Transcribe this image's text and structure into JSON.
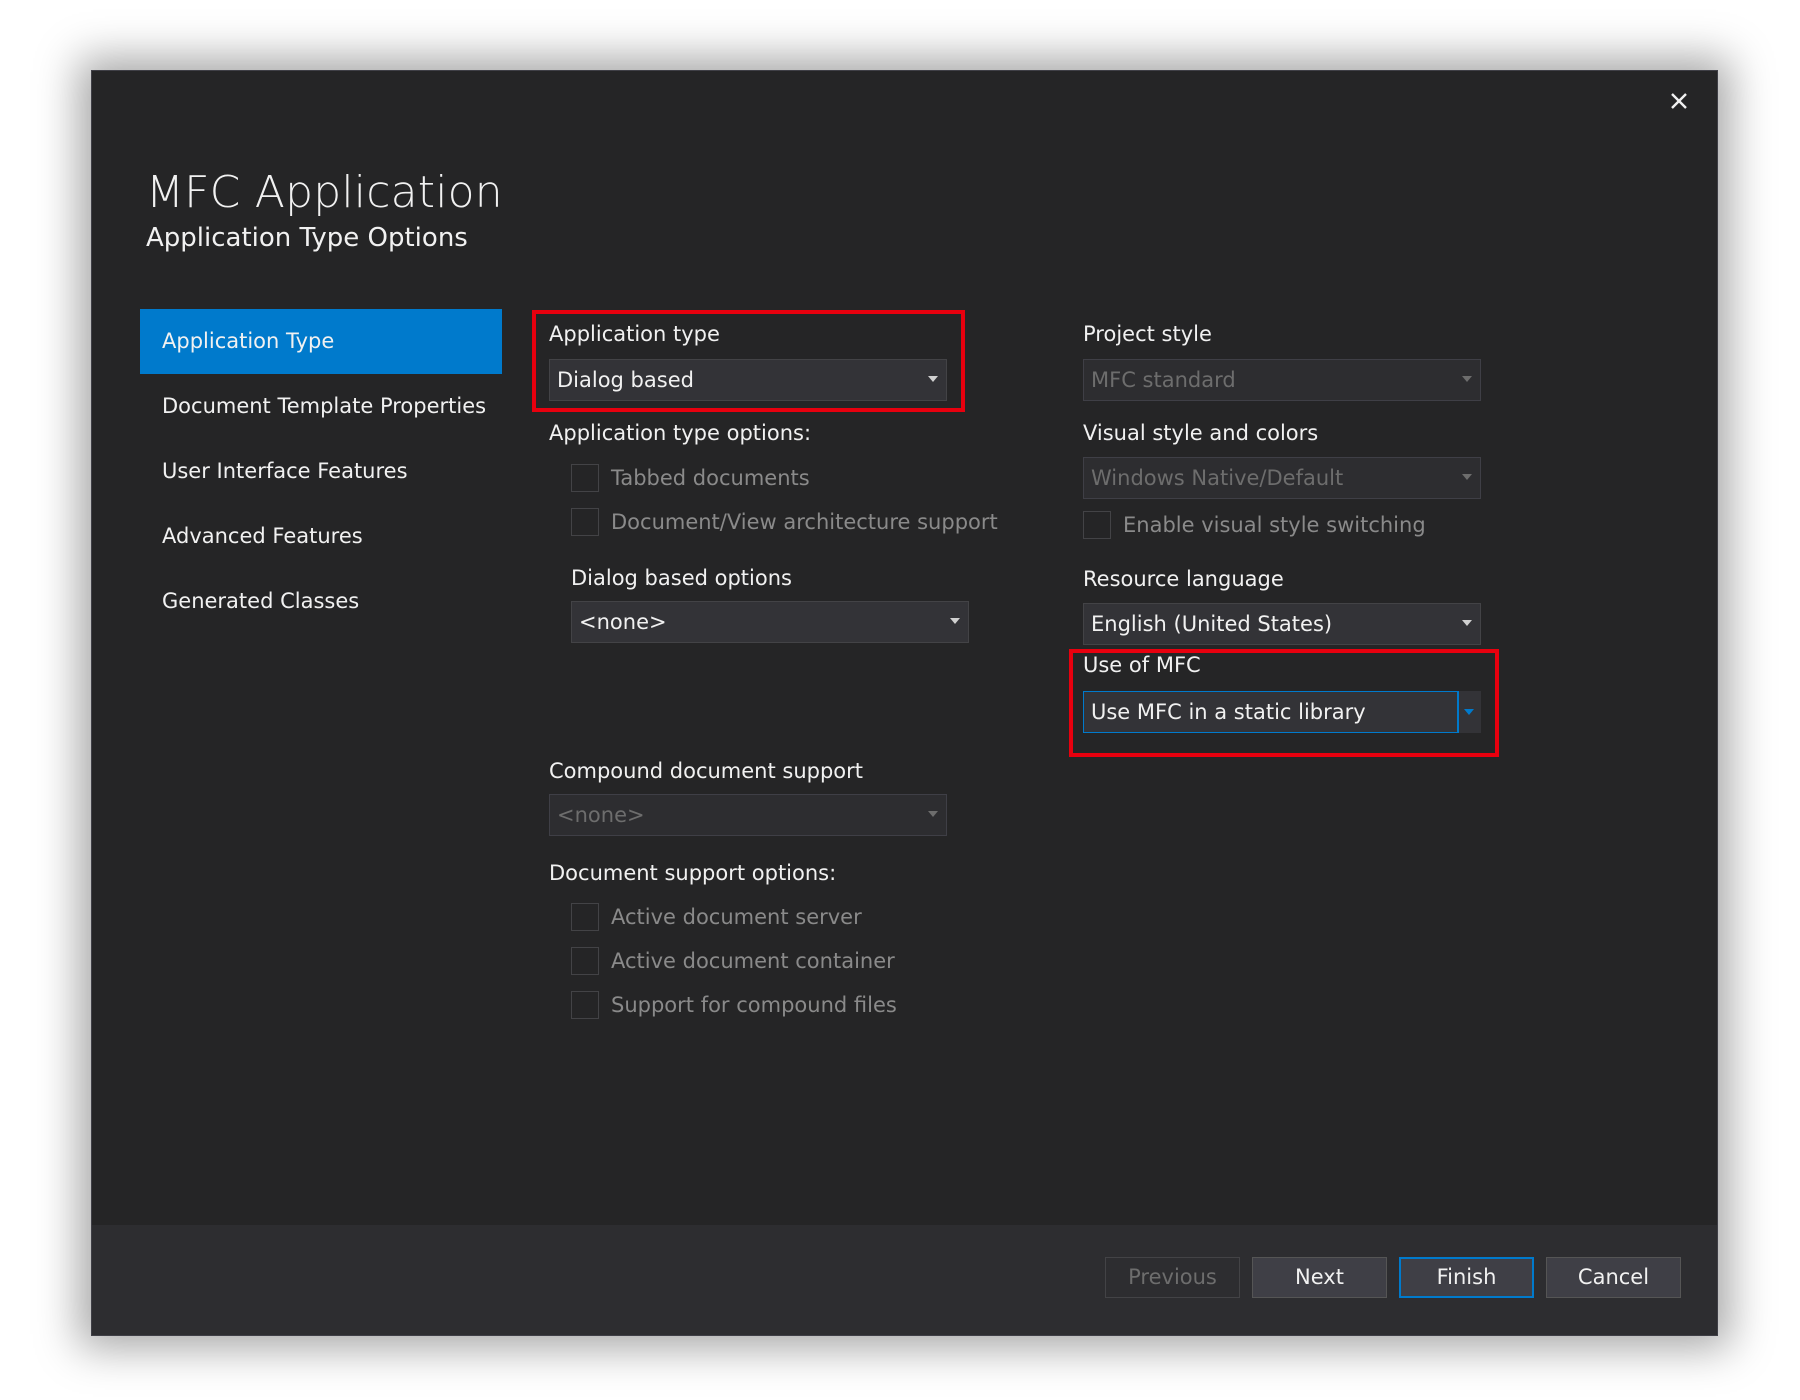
{
  "dialog": {
    "title": "MFC Application",
    "subtitle": "Application Type Options",
    "close_icon": "close-icon"
  },
  "nav": {
    "items": [
      {
        "label": "Application Type",
        "active": true
      },
      {
        "label": "Document Template Properties",
        "active": false
      },
      {
        "label": "User Interface Features",
        "active": false
      },
      {
        "label": "Advanced Features",
        "active": false
      },
      {
        "label": "Generated Classes",
        "active": false
      }
    ]
  },
  "left": {
    "application_type_label": "Application type",
    "application_type_value": "Dialog based",
    "app_type_options_label": "Application type options:",
    "tabbed_documents": "Tabbed documents",
    "doc_view_support": "Document/View architecture support",
    "dialog_options_label": "Dialog based options",
    "dialog_options_value": "<none>",
    "compound_label": "Compound document support",
    "compound_value": "<none>",
    "doc_support_options_label": "Document support options:",
    "active_doc_server": "Active document server",
    "active_doc_container": "Active document container",
    "compound_files": "Support for compound files"
  },
  "right": {
    "project_style_label": "Project style",
    "project_style_value": "MFC standard",
    "visual_style_label": "Visual style and colors",
    "visual_style_value": "Windows Native/Default",
    "enable_switching": "Enable visual style switching",
    "resource_language_label": "Resource language",
    "resource_language_value": "English (United States)",
    "use_of_mfc_label": "Use of MFC",
    "use_of_mfc_value": "Use MFC in a static library"
  },
  "footer": {
    "previous": "Previous",
    "next": "Next",
    "finish": "Finish",
    "cancel": "Cancel"
  },
  "colors": {
    "accent": "#007acc",
    "highlight": "#e8000e",
    "background": "#252526"
  }
}
